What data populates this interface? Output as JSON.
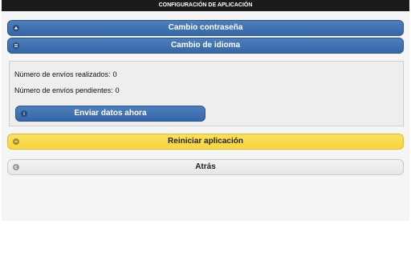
{
  "header": {
    "title": "CONFIGURACIÓN DE APLICACIÓN"
  },
  "buttons": {
    "password": "Cambio contraseña",
    "language": "Cambio de idioma",
    "send_now": "Enviar datos ahora",
    "restart": "Reiniciar aplicación",
    "back": "Atrás"
  },
  "stats": {
    "sent_label": "Número de envíos realizados:",
    "sent_value": "0",
    "pending_label": "Número de envíos pendientes:",
    "pending_value": "0"
  },
  "colors": {
    "header_bg": "#1a1a1a",
    "primary_blue": "#3566a8",
    "warning_yellow": "#f8d53c",
    "neutral_gray": "#e6e6e6"
  },
  "icons": {
    "password": "arrow-up-icon",
    "language": "menu-icon",
    "send_now": "info-icon",
    "restart": "minus-icon",
    "back": "back-arrow-icon"
  }
}
